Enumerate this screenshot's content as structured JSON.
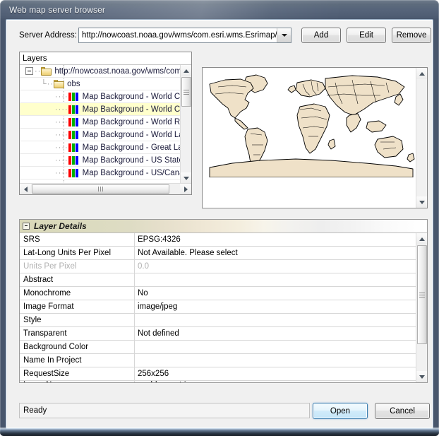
{
  "window": {
    "title": "Web map server browser"
  },
  "server": {
    "label": "Server Address:",
    "address": "http://nowcoast.noaa.gov/wms/com.esri.wms.Esrimap/obs",
    "dropdown_icon": "chevron-down-icon",
    "buttons": {
      "add": "Add",
      "edit": "Edit",
      "remove": "Remove"
    }
  },
  "layers_panel": {
    "header": "Layers",
    "tree": [
      {
        "label": "http://nowcoast.noaa.gov/wms/com.e",
        "icon": "folder-icon",
        "depth": 0,
        "expander": "minus",
        "selected": false
      },
      {
        "label": "obs",
        "icon": "folder-icon",
        "depth": 1,
        "expander": "none",
        "selected": false
      },
      {
        "label": "Map Background - World Coun",
        "icon": "rgb-bars-icon",
        "depth": 2,
        "expander": "none",
        "selected": false
      },
      {
        "label": "Map Background - World Coun",
        "icon": "rgb-bars-icon",
        "depth": 2,
        "expander": "none",
        "selected": true
      },
      {
        "label": "Map Background - World River",
        "icon": "rgb-bars-icon",
        "depth": 2,
        "expander": "none",
        "selected": false
      },
      {
        "label": "Map Background - World Lake",
        "icon": "rgb-bars-icon",
        "depth": 2,
        "expander": "none",
        "selected": false
      },
      {
        "label": "Map Background - Great Lakes",
        "icon": "rgb-bars-icon",
        "depth": 2,
        "expander": "none",
        "selected": false
      },
      {
        "label": "Map Background - US States -",
        "icon": "rgb-bars-icon",
        "depth": 2,
        "expander": "none",
        "selected": false
      },
      {
        "label": "Map Background - US/Canada",
        "icon": "rgb-bars-icon",
        "depth": 2,
        "expander": "none",
        "selected": false
      }
    ]
  },
  "preview": {
    "name": "world-map-preview",
    "land_color": "#efe1c8",
    "outline_color": "#000000",
    "background_color": "#ffffff"
  },
  "details": {
    "title": "Layer Details",
    "rows": [
      {
        "key": "SRS",
        "value": "EPSG:4326",
        "disabled": false
      },
      {
        "key": "Lat-Long Units Per Pixel",
        "value": "Not Available. Please select",
        "disabled": false
      },
      {
        "key": "Units Per Pixel",
        "value": "0.0",
        "disabled": true
      },
      {
        "key": "Abstract",
        "value": "",
        "disabled": false
      },
      {
        "key": "Monochrome",
        "value": "No",
        "disabled": false
      },
      {
        "key": "Image Format",
        "value": "image/jpeg",
        "disabled": false
      },
      {
        "key": "Style",
        "value": "",
        "disabled": false
      },
      {
        "key": "Transparent",
        "value": "Not defined",
        "disabled": false
      },
      {
        "key": "Background Color",
        "value": "",
        "disabled": false
      },
      {
        "key": "Name In Project",
        "value": "",
        "disabled": false
      },
      {
        "key": "RequestSize",
        "value": "256x256",
        "disabled": false
      },
      {
        "key": "Layer Names",
        "value": "world_countries",
        "disabled": false
      }
    ]
  },
  "statusbar": {
    "text": "Ready"
  },
  "footer": {
    "open": "Open",
    "cancel": "Cancel"
  }
}
